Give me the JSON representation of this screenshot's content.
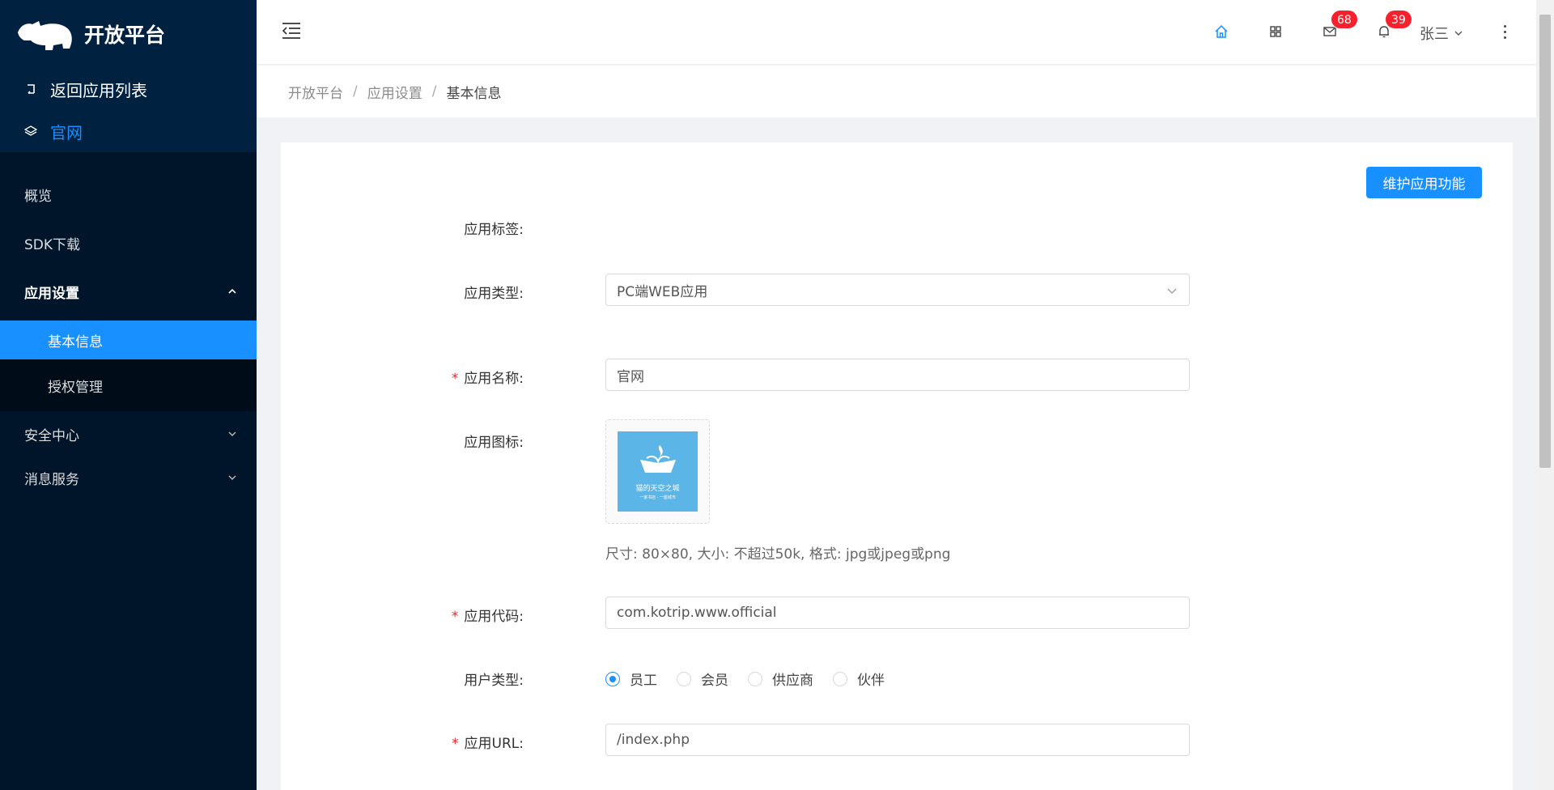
{
  "sidebar": {
    "logo_text": "开放平台",
    "back_label": "返回应用列表",
    "current_app": "官网",
    "menu": [
      {
        "label": "概览"
      },
      {
        "label": "SDK下载"
      },
      {
        "label": "应用设置",
        "expanded": true,
        "children": [
          {
            "label": "基本信息",
            "active": true
          },
          {
            "label": "授权管理"
          }
        ]
      },
      {
        "label": "安全中心"
      },
      {
        "label": "消息服务"
      }
    ]
  },
  "header": {
    "mail_badge": "68",
    "bell_badge": "39",
    "user_name": "张三"
  },
  "breadcrumb": {
    "items": [
      "开放平台",
      "应用设置",
      "基本信息"
    ],
    "separator": "/"
  },
  "form": {
    "maintain_button": "维护应用功能",
    "tag_label": "应用标签:",
    "type_label": "应用类型:",
    "type_value": "PC端WEB应用",
    "name_label": "应用名称:",
    "name_value": "官网",
    "icon_label": "应用图标:",
    "icon_text_main": "猫的天空之城",
    "icon_text_sub": "一家书店 · 一座城市",
    "icon_hint": "尺寸: 80×80, 大小: 不超过50k, 格式: jpg或jpeg或png",
    "code_label": "应用代码:",
    "code_value": "com.kotrip.www.official",
    "user_type_label": "用户类型:",
    "user_types": [
      {
        "label": "员工",
        "checked": true
      },
      {
        "label": "会员",
        "checked": false
      },
      {
        "label": "供应商",
        "checked": false
      },
      {
        "label": "伙伴",
        "checked": false
      }
    ],
    "url_label": "应用URL:",
    "url_value": "/index.php",
    "required_mark": "*"
  },
  "colors": {
    "primary": "#1890ff",
    "sidebar_bg": "#001529",
    "badge": "#f5222d"
  }
}
